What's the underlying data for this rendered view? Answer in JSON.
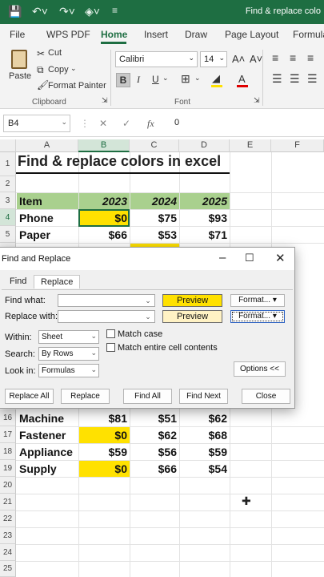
{
  "window": {
    "title": "Find & replace colo"
  },
  "quick_access": {
    "save_icon": "save-icon",
    "undo_icon": "undo-icon",
    "redo_icon": "redo-icon",
    "sensitivity_icon": "sensitivity-icon",
    "more_icon": "customize-icon"
  },
  "ribbon_tabs": [
    "File",
    "WPS PDF",
    "Home",
    "Insert",
    "Draw",
    "Page Layout",
    "Formula"
  ],
  "ribbon": {
    "paste": "Paste",
    "cut": "Cut",
    "copy": "Copy",
    "format_painter": "Format Painter",
    "clipboard_label": "Clipboard",
    "font_name": "Calibri",
    "font_size": "14",
    "grow_font": "A˄",
    "shrink_font": "A˅",
    "bold": "B",
    "italic": "I",
    "underline": "U",
    "font_label": "Font",
    "font_color": "A"
  },
  "formula_bar": {
    "name_box": "B4",
    "value": "0",
    "cancel": "✕",
    "enter": "✓",
    "fx": "fx"
  },
  "columns": [
    "A",
    "B",
    "C",
    "D",
    "E",
    "F"
  ],
  "rows": [
    "1",
    "2",
    "3",
    "4",
    "5",
    "16",
    "17",
    "18",
    "19",
    "20",
    "21",
    "22",
    "23",
    "24",
    "25"
  ],
  "sheet": {
    "title": "Find & replace colors in excel",
    "header": [
      "Item",
      "2023",
      "2024",
      "2025"
    ],
    "top_rows": [
      [
        "Phone",
        "$0",
        "$75",
        "$93"
      ],
      [
        "Paper",
        "$66",
        "$53",
        "$71"
      ]
    ],
    "bottom_rows": [
      [
        "Machine",
        "$81",
        "$51",
        "$62"
      ],
      [
        "Fastener",
        "$0",
        "$62",
        "$68"
      ],
      [
        "Appliance",
        "$59",
        "$56",
        "$59"
      ],
      [
        "Supply",
        "$0",
        "$66",
        "$54"
      ]
    ]
  },
  "dialog": {
    "title": "Find and Replace",
    "tab_find": "Find",
    "tab_replace": "Replace",
    "find_what_label": "Find what:",
    "replace_with_label": "Replace with:",
    "find_what_value": "",
    "replace_with_value": "",
    "preview_find": "Preview",
    "preview_replace": "Preview",
    "format_find": "Format...",
    "format_replace": "Format...",
    "within_label": "Within:",
    "within_value": "Sheet",
    "search_label": "Search:",
    "search_value": "By Rows",
    "look_in_label": "Look in:",
    "look_in_value": "Formulas",
    "match_case": "Match case",
    "match_entire": "Match entire cell contents",
    "options_btn": "Options <<",
    "replace_all": "Replace All",
    "replace": "Replace",
    "find_all": "Find All",
    "find_next": "Find Next",
    "close": "Close"
  },
  "colors": {
    "excel_green": "#1e6e42",
    "header_green": "#a9d08e",
    "highlight_yellow": "#ffe100"
  }
}
